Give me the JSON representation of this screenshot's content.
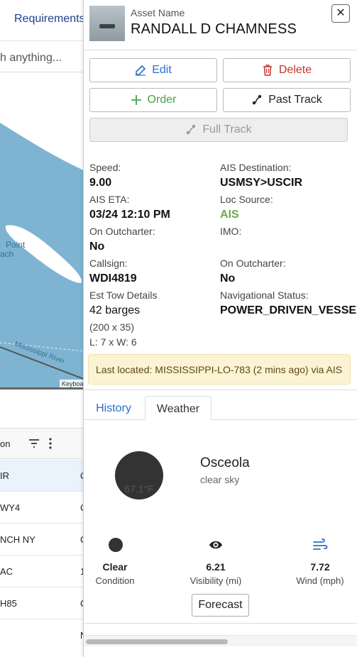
{
  "background": {
    "nav_label": "Requirements",
    "search_placeholder": "h anything...",
    "map_label_line1": "Point",
    "map_label_line2": "ach",
    "map_river": "Mississippi River",
    "map_attribution": "Keyboa",
    "grid_header": "on",
    "grid_rows": [
      {
        "c1": "IR",
        "c2": "C"
      },
      {
        "c1": "WY4",
        "c2": "C"
      },
      {
        "c1": "NCH NY",
        "c2": "C"
      },
      {
        "c1": "AC",
        "c2": "1"
      },
      {
        "c1": "H85",
        "c2": "C"
      },
      {
        "c1": "",
        "c2": "N"
      }
    ]
  },
  "panel": {
    "asset_label": "Asset Name",
    "asset_name": "RANDALL D CHAMNESS",
    "close_label": "✕",
    "buttons": {
      "edit": "Edit",
      "delete": "Delete",
      "order": "Order",
      "past_track": "Past Track",
      "full_track": "Full Track"
    },
    "details": {
      "speed_label": "Speed:",
      "speed_value": "9.00",
      "ais_dest_label": "AIS Destination:",
      "ais_dest_value": "USMSY>USCIR",
      "ais_eta_label": "AIS ETA:",
      "ais_eta_value": "03/24 12:10 PM",
      "loc_source_label": "Loc Source:",
      "loc_source_value": "AIS",
      "outcharter_label": "On Outcharter:",
      "outcharter_value": "No",
      "imo_label": "IMO:",
      "callsign_label": "Callsign:",
      "callsign_value": "WDI4819",
      "outcharter2_label": "On Outcharter:",
      "outcharter2_value": "No",
      "tow_label": "Est Tow Details",
      "tow_value": "42 barges",
      "tow_dims": "(200 x 35)",
      "tow_lw": "L: 7 x W: 6",
      "nav_status_label": "Navigational Status:",
      "nav_status_value": "POWER_DRIVEN_VESSEL"
    },
    "last_located": "Last located: MISSISSIPPI-LO-783 (2 mins ago) via AIS",
    "tabs": {
      "history": "History",
      "weather": "Weather"
    },
    "weather": {
      "temp": "67.1°F",
      "city": "Osceola",
      "description": "clear sky",
      "condition_value": "Clear",
      "condition_label": "Condition",
      "visibility_value": "6.21",
      "visibility_label": "Visibility (mi)",
      "wind_value": "7.72",
      "wind_label": "Wind (mph)",
      "forecast_button": "Forecast"
    }
  }
}
